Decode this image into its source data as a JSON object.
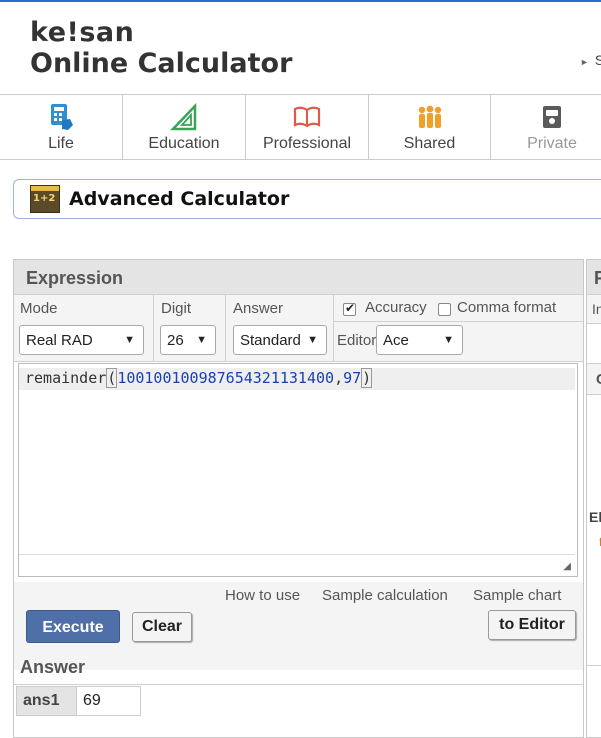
{
  "header": {
    "logo_line1": "ke!san",
    "logo_line2": "Online Calculator",
    "link_partial": "S"
  },
  "tabs": [
    {
      "label": "Life",
      "icon": "calculator-hand-icon"
    },
    {
      "label": "Education",
      "icon": "triangle-ruler-icon"
    },
    {
      "label": "Professional",
      "icon": "open-book-icon"
    },
    {
      "label": "Shared",
      "icon": "people-icon"
    },
    {
      "label": "Private",
      "icon": "private-book-icon"
    }
  ],
  "page_title": "Advanced Calculator",
  "page_title_icon_text": "1+2",
  "expression": {
    "header": "Expression",
    "mode": {
      "label": "Mode",
      "value": "Real RAD"
    },
    "digit": {
      "label": "Digit",
      "value": "26"
    },
    "answer": {
      "label": "Answer",
      "value": "Standard"
    },
    "accuracy": {
      "label": "Accuracy",
      "checked": true
    },
    "comma_format": {
      "label": "Comma format",
      "checked": false
    },
    "editor": {
      "label": "Editor",
      "value": "Ace"
    },
    "code": {
      "func": "remainder",
      "open": "(",
      "arg1": "1001001009876543211314​00",
      "comma": ",",
      "arg2": "97",
      "close": ")"
    }
  },
  "links": {
    "how_to_use": "How to use",
    "sample_calculation": "Sample calculation",
    "sample_chart": "Sample chart"
  },
  "buttons": {
    "execute": "Execute",
    "clear": "Clear",
    "to_editor": "to Editor"
  },
  "answer": {
    "header": "Answer",
    "key": "ans1",
    "value": "69"
  },
  "right_panel": {
    "header_partial": "F",
    "sub_partial": "In",
    "row_partial": "C",
    "el_partial": "El",
    "dot_partial": "f"
  },
  "colors": {
    "accent_blue": "#4f6fa8",
    "code_number": "#1a3fb5",
    "logo_plus": "#e23b3b",
    "top_line": "#2a6bc9"
  }
}
